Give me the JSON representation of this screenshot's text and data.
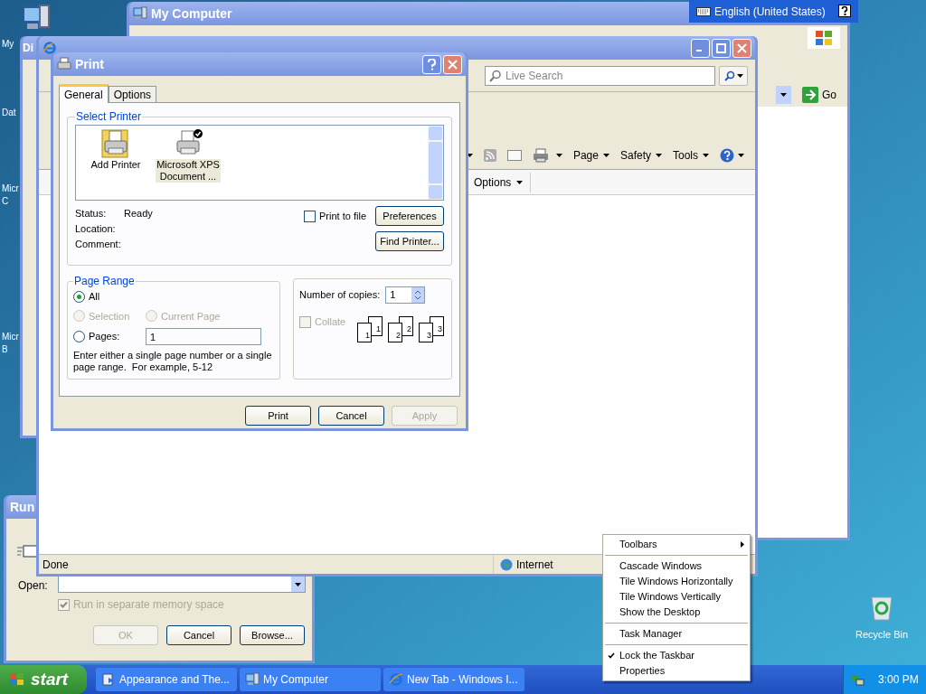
{
  "desktop_icons": [
    {
      "lines": [
        "My"
      ]
    },
    {
      "lines": [
        "Dat"
      ]
    },
    {
      "lines": [
        "Micr",
        "C"
      ]
    },
    {
      "lines": [
        "Micr",
        "B"
      ]
    }
  ],
  "recycle_bin": {
    "label": "Recycle Bin"
  },
  "my_computer": {
    "title": "My Computer",
    "go_button": "Go"
  },
  "language_bar": {
    "label": "English (United States)"
  },
  "back_window": {
    "title": "Di"
  },
  "browser": {
    "search": {
      "placeholder": "Live Search"
    },
    "commands": [
      "Page",
      "Safety",
      "Tools"
    ],
    "tab_options": "Options",
    "status": "Done",
    "zone": "Internet"
  },
  "print_dialog": {
    "title": "Print",
    "tabs": [
      {
        "label": "General",
        "selected": true
      },
      {
        "label": "Options",
        "selected": false
      }
    ],
    "select_printer": {
      "legend": "Select Printer",
      "printers": [
        {
          "lines": [
            "Add Printer"
          ],
          "selected": false,
          "default": false
        },
        {
          "lines": [
            "Microsoft XPS",
            "Document ..."
          ],
          "selected": true,
          "default": true
        }
      ]
    },
    "info": [
      {
        "label": "Status:",
        "value": "Ready"
      },
      {
        "label": "Location:"
      },
      {
        "label": "Comment:"
      }
    ],
    "print_to_file": {
      "label": "Print to file",
      "checked": false
    },
    "preferences_button": "Preferences",
    "find_printer_button": "Find Printer...",
    "page_range": {
      "legend": "Page Range",
      "options": [
        {
          "label": "All",
          "selected": true,
          "disabled": false
        },
        {
          "label": "Selection",
          "selected": false,
          "disabled": true
        },
        {
          "label": "Current Page",
          "selected": false,
          "disabled": true
        },
        {
          "label": "Pages:",
          "selected": false,
          "disabled": false
        }
      ],
      "pages_value": "1",
      "hint": "Enter either a single page number or a single page range.  For example, 5-12"
    },
    "copies": {
      "label": "Number of copies:",
      "value": "1",
      "collate": {
        "label": "Collate",
        "checked": false,
        "disabled": true
      },
      "pages": [
        "1",
        "1",
        "2",
        "2",
        "3",
        "3"
      ]
    },
    "buttons": [
      {
        "label": "Print",
        "disabled": false
      },
      {
        "label": "Cancel",
        "disabled": false
      },
      {
        "label": "Apply",
        "disabled": true
      }
    ]
  },
  "run_dialog": {
    "title": "Run",
    "open_label": "Open:",
    "option": {
      "label": "Run in separate memory space",
      "checked": true,
      "disabled": true
    },
    "buttons": [
      {
        "label": "OK",
        "disabled": true
      },
      {
        "label": "Cancel",
        "disabled": false
      },
      {
        "label": "Browse...",
        "disabled": false
      }
    ]
  },
  "context_menu": [
    {
      "kind": "submenu",
      "label": "Toolbars"
    },
    {
      "kind": "separator"
    },
    {
      "kind": "item",
      "label": "Cascade Windows",
      "checked": false
    },
    {
      "kind": "item",
      "label": "Tile Windows Horizontally",
      "checked": false
    },
    {
      "kind": "item",
      "label": "Tile Windows Vertically",
      "checked": false
    },
    {
      "kind": "item",
      "label": "Show the Desktop",
      "checked": false
    },
    {
      "kind": "separator"
    },
    {
      "kind": "item",
      "label": "Task Manager",
      "checked": false
    },
    {
      "kind": "separator"
    },
    {
      "kind": "item",
      "label": "Lock the Taskbar",
      "checked": true
    },
    {
      "kind": "item",
      "label": "Properties",
      "checked": false
    }
  ],
  "taskbar": {
    "start": "start",
    "tasks": [
      {
        "label": "Appearance and The...",
        "selected": false
      },
      {
        "label": "My Computer",
        "selected": false
      },
      {
        "label": "New Tab - Windows I...",
        "selected": false
      }
    ],
    "clock": "3:00 PM"
  }
}
